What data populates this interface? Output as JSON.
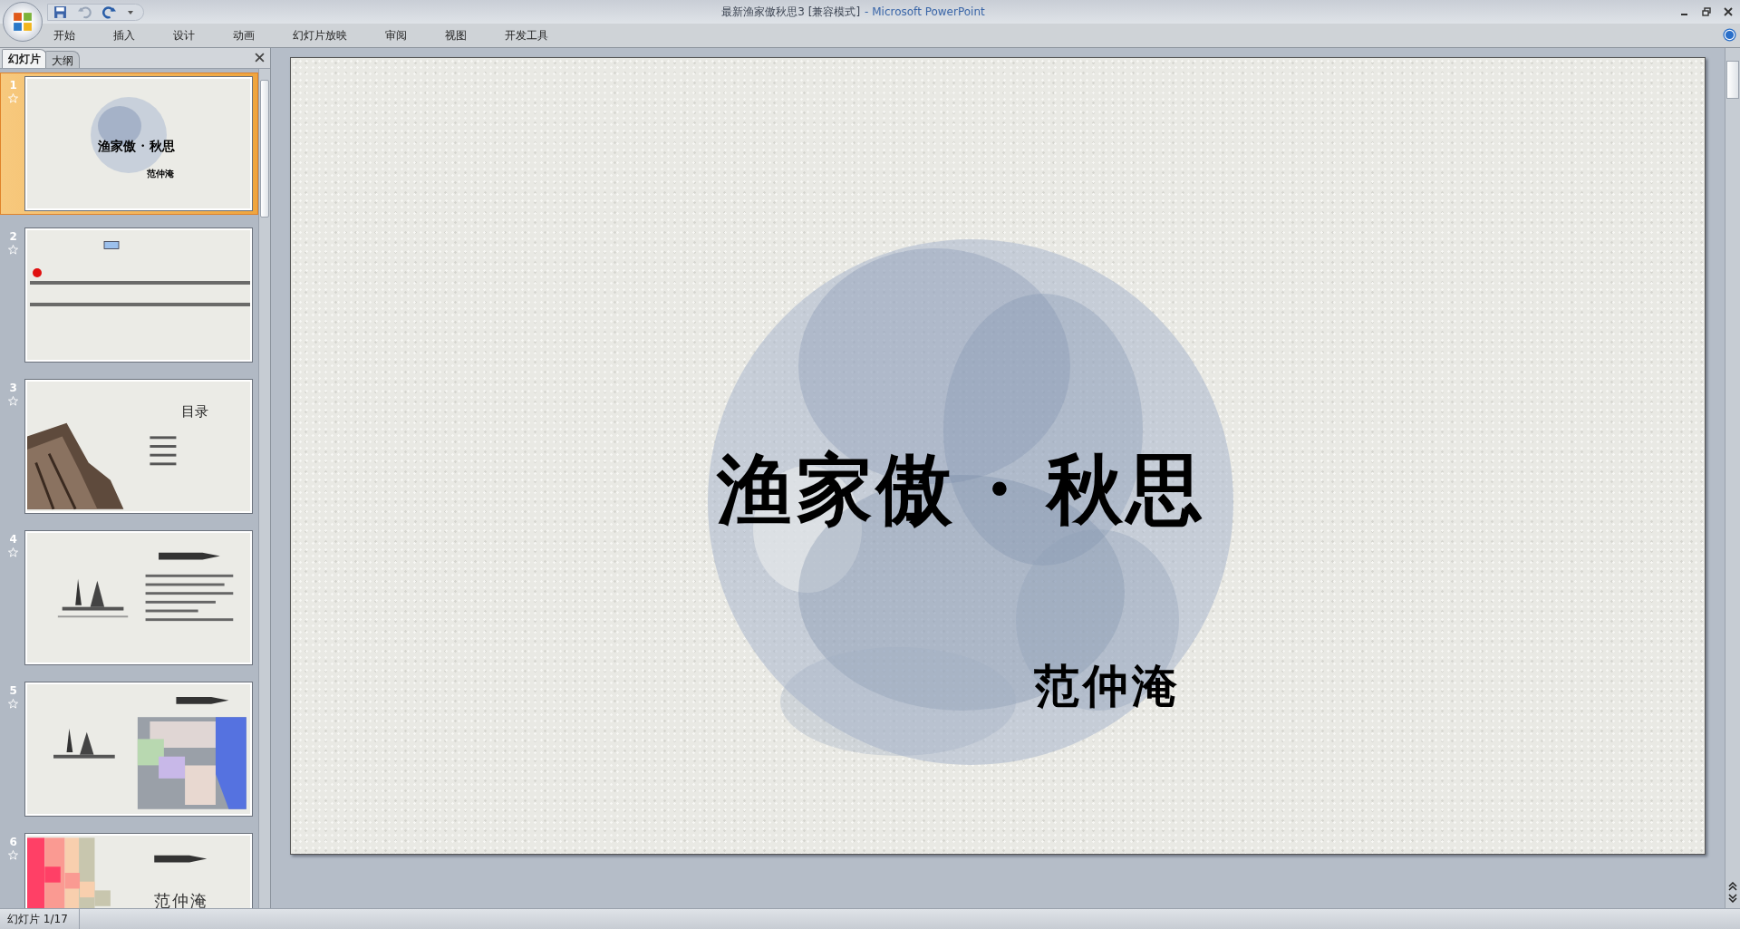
{
  "window": {
    "title": "最新渔家傲秋思3 [兼容模式]",
    "app": "- Microsoft PowerPoint"
  },
  "ribbon_tabs": [
    "开始",
    "插入",
    "设计",
    "动画",
    "幻灯片放映",
    "审阅",
    "视图",
    "开发工具"
  ],
  "panel_tabs": [
    {
      "label": "幻灯片",
      "selected": true
    },
    {
      "label": "大纲",
      "selected": false
    }
  ],
  "slides": [
    {
      "number": "1",
      "selected": true,
      "kind": "title",
      "title": "渔家傲 · 秋思",
      "subtitle": "范仲淹"
    },
    {
      "number": "2",
      "selected": false,
      "kind": "text"
    },
    {
      "number": "3",
      "selected": false,
      "kind": "toc",
      "title": "目录"
    },
    {
      "number": "4",
      "selected": false,
      "kind": "boats"
    },
    {
      "number": "5",
      "selected": false,
      "kind": "map"
    },
    {
      "number": "6",
      "selected": false,
      "kind": "author",
      "title": "范仲淹"
    }
  ],
  "current_slide": {
    "title": "渔家傲 · 秋思",
    "subtitle": "范仲淹"
  },
  "status_bar": {
    "slide_count": "幻灯片 1/17"
  }
}
